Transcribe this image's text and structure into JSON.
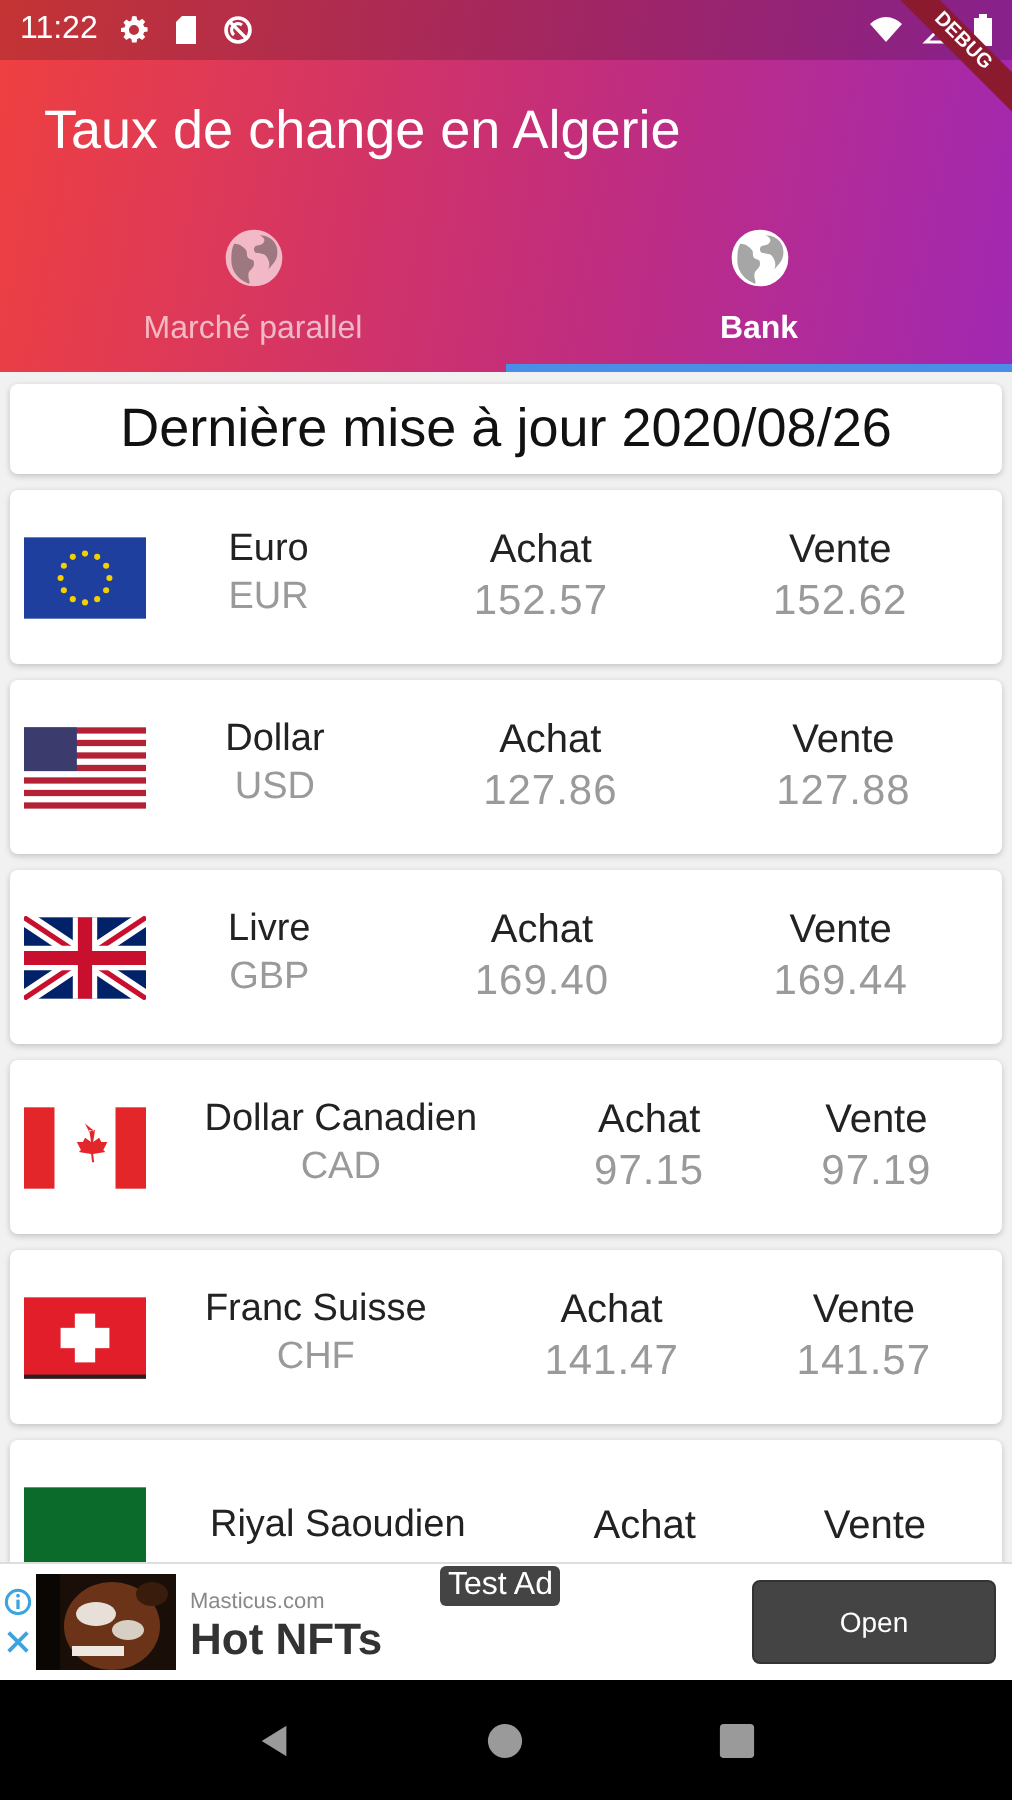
{
  "status_bar": {
    "time": "11:22"
  },
  "debug_banner": "DEBUG",
  "app_bar": {
    "title": "Taux de change en Algerie"
  },
  "tabs": [
    {
      "label": "Marché parallel",
      "selected": false
    },
    {
      "label": "Bank",
      "selected": true
    }
  ],
  "update_banner": "Dernière mise à jour 2020/08/26",
  "rates": [
    {
      "kind": "eu",
      "name": "Euro",
      "code": "EUR",
      "buy_label": "Achat",
      "buy": "152.57",
      "sell_label": "Vente",
      "sell": "152.62"
    },
    {
      "kind": "us",
      "name": "Dollar",
      "code": "USD",
      "buy_label": "Achat",
      "buy": "127.86",
      "sell_label": "Vente",
      "sell": "127.88"
    },
    {
      "kind": "uk",
      "name": "Livre",
      "code": "GBP",
      "buy_label": "Achat",
      "buy": "169.40",
      "sell_label": "Vente",
      "sell": "169.44"
    },
    {
      "kind": "ca",
      "name": "Dollar Canadien",
      "code": "CAD",
      "buy_label": "Achat",
      "buy": "97.15",
      "sell_label": "Vente",
      "sell": "97.19"
    },
    {
      "kind": "ch",
      "name": "Franc Suisse",
      "code": "CHF",
      "buy_label": "Achat",
      "buy": "141.47",
      "sell_label": "Vente",
      "sell": "141.57"
    },
    {
      "kind": "sa",
      "name": "Riyal Saoudien",
      "buy_label": "Achat",
      "sell_label": "Vente"
    }
  ],
  "ad": {
    "badge": "Test Ad",
    "advertiser": "Masticus.com",
    "headline": "Hot NFTs",
    "button": "Open"
  }
}
